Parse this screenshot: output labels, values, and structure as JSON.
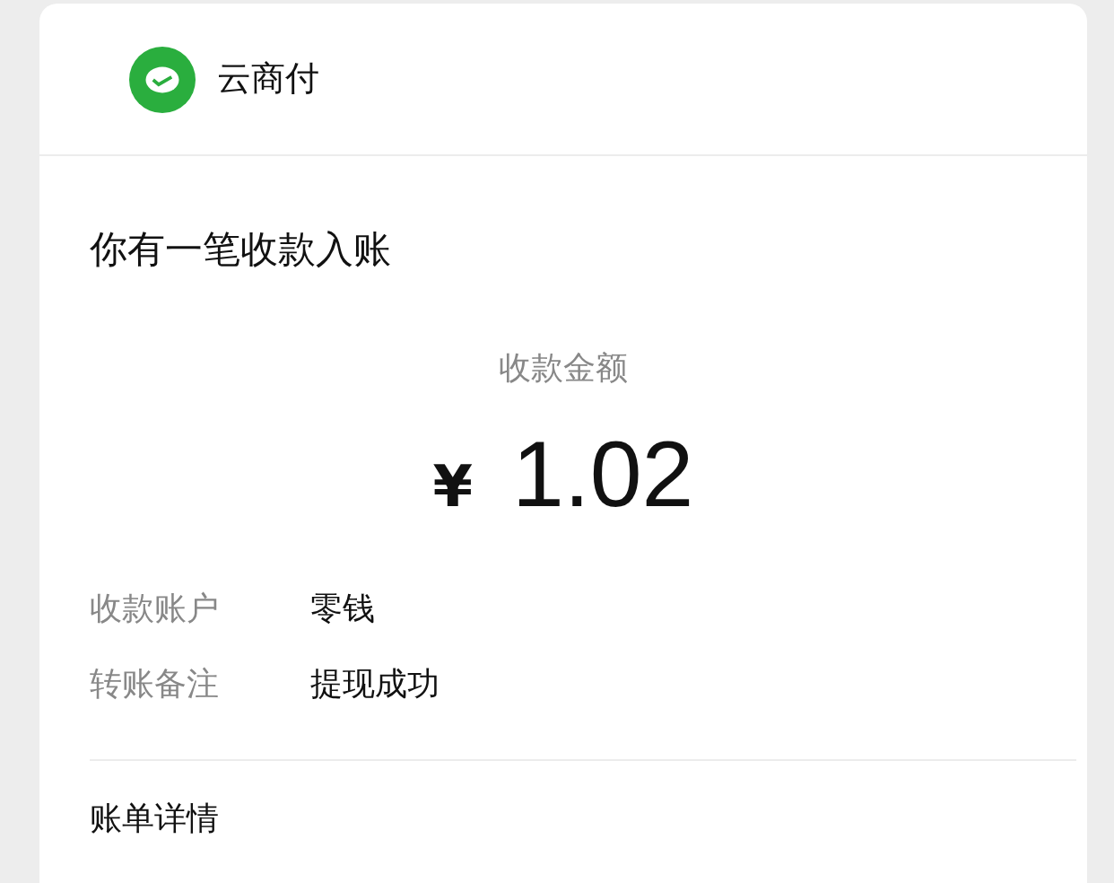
{
  "header": {
    "app_name": "云商付"
  },
  "notice": {
    "title": "你有一笔收款入账"
  },
  "amount": {
    "label": "收款金额",
    "currency": "¥",
    "value": "1.02"
  },
  "details": [
    {
      "label": "收款账户",
      "value": "零钱"
    },
    {
      "label": "转账备注",
      "value": "提现成功"
    }
  ],
  "footer": {
    "link": "账单详情"
  }
}
